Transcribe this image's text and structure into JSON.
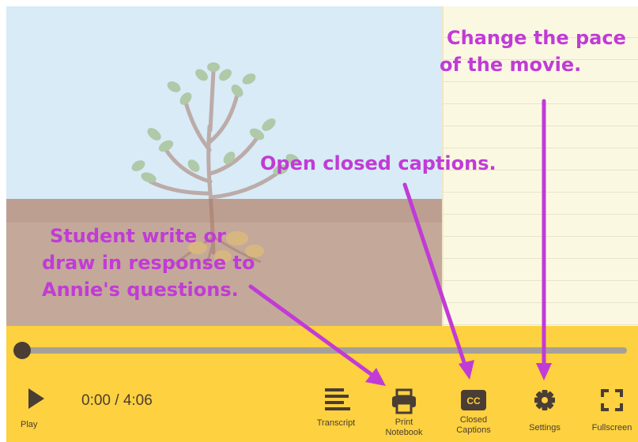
{
  "player": {
    "time_display": "0:00 / 4:06",
    "progress": 0,
    "controls": {
      "play": "Play",
      "transcript": "Transcript",
      "print_notebook_line1": "Print",
      "print_notebook_line2": "Notebook",
      "closed_captions_line1": "Closed",
      "closed_captions_line2": "Captions",
      "settings": "Settings",
      "fullscreen": "Fullscreen"
    },
    "colors": {
      "control_bar": "#fdd13f",
      "icon": "#4a3d34",
      "annotation": "#c13bd6"
    }
  },
  "annotations": {
    "notebook_line1": "Student write or",
    "notebook_line2": "draw in response to",
    "notebook_line3": "Annie's questions.",
    "captions": "Open closed captions.",
    "pace_line1": "Change the pace",
    "pace_line2": "of the movie."
  }
}
